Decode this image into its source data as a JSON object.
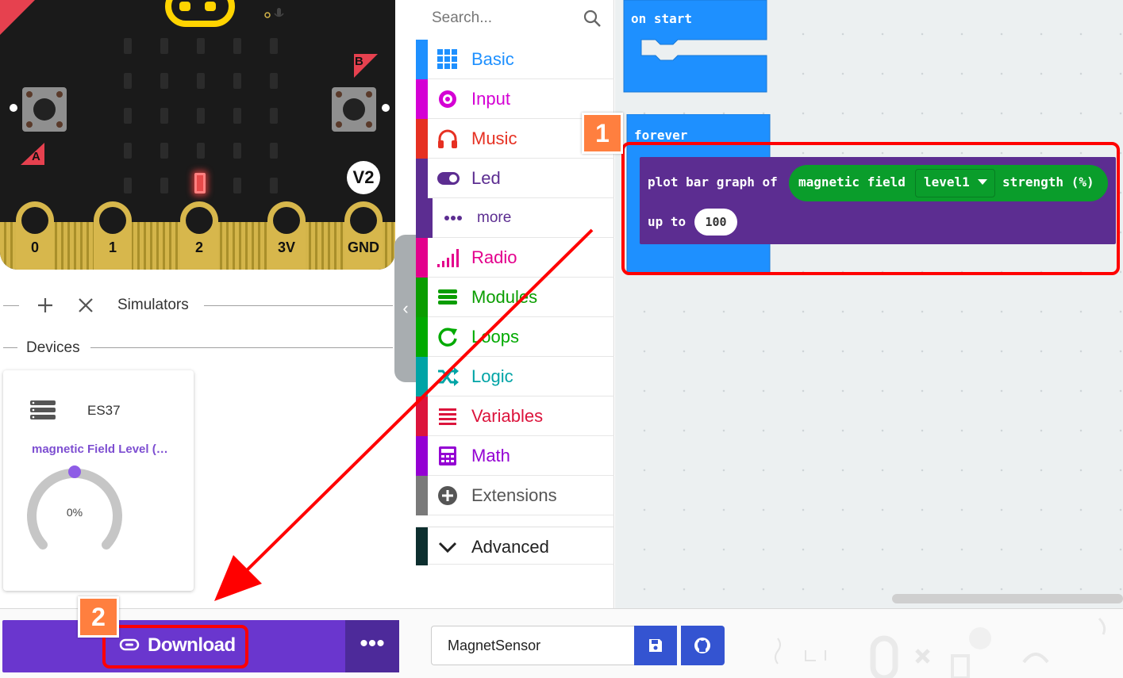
{
  "simulator": {
    "pin_labels": [
      "0",
      "1",
      "2",
      "3V",
      "GND"
    ],
    "button_a_label": "A",
    "button_b_label": "B",
    "version_badge": "V2"
  },
  "sim_toolbar": {
    "minimize_icon": "minus-icon",
    "add_icon": "plus-icon",
    "close_icon": "close-icon",
    "simulators_label": "Simulators"
  },
  "devices": {
    "section_label": "Devices",
    "card": {
      "name": "ES37",
      "subtitle": "magnetic Field Level (%)",
      "gauge_value": "0%",
      "gauge_level": 0.0
    }
  },
  "toolbox": {
    "search_placeholder": "Search...",
    "categories": [
      {
        "label": "Basic",
        "color": "#1e90ff",
        "icon": "grid-icon"
      },
      {
        "label": "Input",
        "color": "#d400d4",
        "icon": "target-icon"
      },
      {
        "label": "Music",
        "color": "#e63022",
        "icon": "headphones-icon"
      },
      {
        "label": "Led",
        "color": "#5c2d91",
        "icon": "toggle-icon"
      },
      {
        "label": "more",
        "color": "#5c2d91",
        "icon": "ellipsis-icon"
      },
      {
        "label": "Radio",
        "color": "#e3008c",
        "icon": "signal-icon"
      },
      {
        "label": "Modules",
        "color": "#0a9d00",
        "icon": "modules-icon"
      },
      {
        "label": "Loops",
        "color": "#00aa00",
        "icon": "loop-icon"
      },
      {
        "label": "Logic",
        "color": "#00a4a6",
        "icon": "shuffle-icon"
      },
      {
        "label": "Variables",
        "color": "#dc143c",
        "icon": "list-icon"
      },
      {
        "label": "Math",
        "color": "#9400d3",
        "icon": "calculator-icon"
      },
      {
        "label": "Extensions",
        "color": "#555555",
        "icon": "plus-circle-icon"
      },
      {
        "label": "Advanced",
        "color": "#222222",
        "icon": "chevron-down-icon"
      }
    ]
  },
  "workspace": {
    "on_start_label": "on start",
    "forever_label": "forever",
    "plot_block": {
      "prefix": "plot bar graph of",
      "sensor_label": "magnetic field",
      "dropdown_value": "level1",
      "suffix": "strength (%)",
      "upto_label": "up to",
      "upto_value": "100"
    }
  },
  "bottom_bar": {
    "download_label": "Download",
    "more_label": "•••",
    "project_name": "MagnetSensor"
  },
  "annotations": {
    "step1": "1",
    "step2": "2",
    "highlight_color": "#ff0000",
    "badge_color": "#ff7f3f"
  }
}
